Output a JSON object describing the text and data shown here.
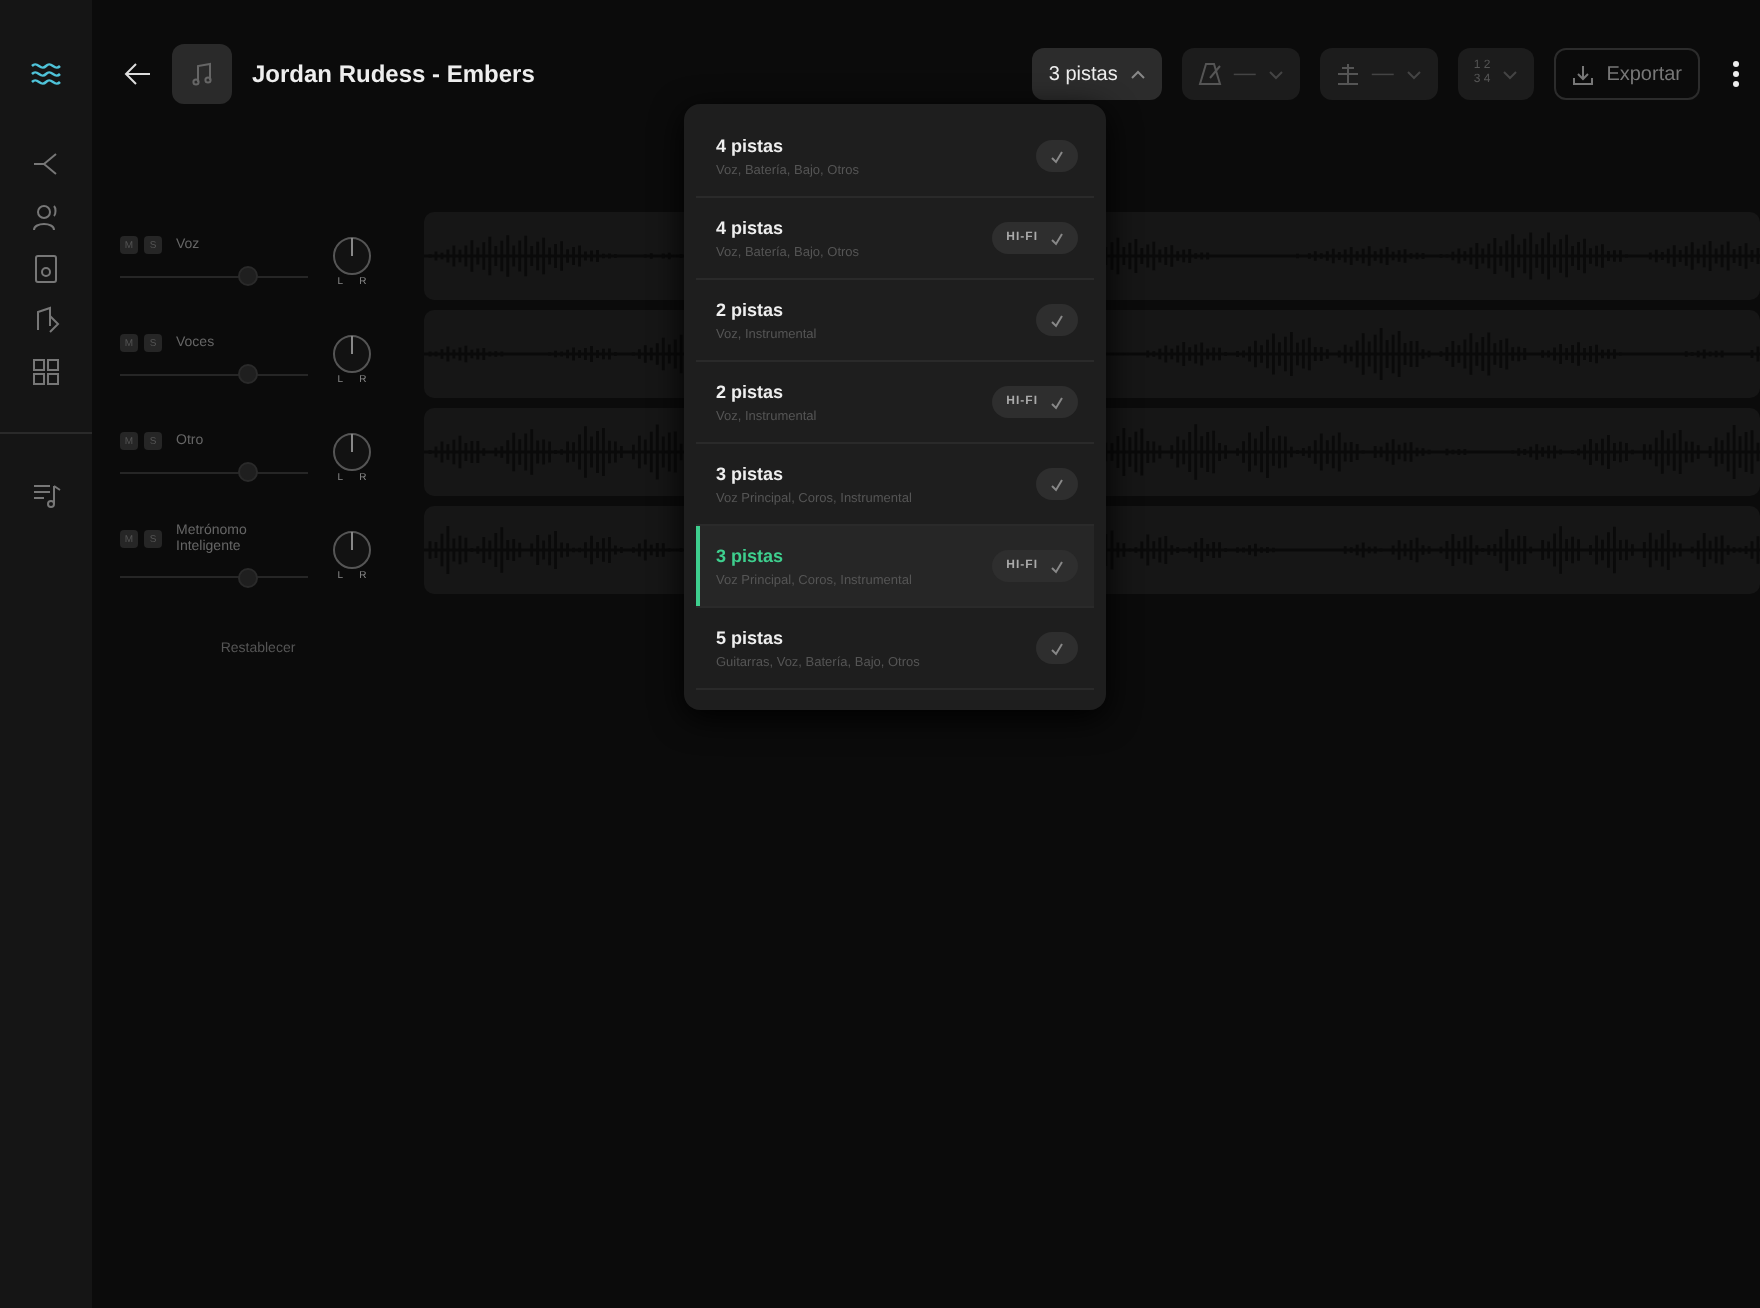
{
  "header": {
    "title": "Jordan Rudess - Embers"
  },
  "toolbar": {
    "stems_label": "3 pistas",
    "metronome_value": "—",
    "tuning_value": "—",
    "time_signature": [
      "1 2",
      "3 4"
    ],
    "export_label": "Exportar"
  },
  "tracks": [
    {
      "name": "Voz",
      "mute_label": "M",
      "solo_label": "S",
      "level": 0.7,
      "pan_left": "L",
      "pan_right": "R"
    },
    {
      "name": "Voces",
      "mute_label": "M",
      "solo_label": "S",
      "level": 0.7,
      "pan_left": "L",
      "pan_right": "R"
    },
    {
      "name": "Otro",
      "mute_label": "M",
      "solo_label": "S",
      "level": 0.7,
      "pan_left": "L",
      "pan_right": "R"
    },
    {
      "name": "Metrónomo Inteligente",
      "mute_label": "M",
      "solo_label": "S",
      "level": 0.7,
      "pan_left": "L",
      "pan_right": "R"
    }
  ],
  "reset_label": "Restablecer",
  "stem_options": [
    {
      "title": "4 pistas",
      "subtitle": "Voz, Batería, Bajo, Otros",
      "hifi": false,
      "selected": false
    },
    {
      "title": "4 pistas",
      "subtitle": "Voz, Batería, Bajo, Otros",
      "hifi": true,
      "hifi_label": "HI-FI",
      "selected": false
    },
    {
      "title": "2 pistas",
      "subtitle": "Voz, Instrumental",
      "hifi": false,
      "selected": false
    },
    {
      "title": "2 pistas",
      "subtitle": "Voz, Instrumental",
      "hifi": true,
      "hifi_label": "HI-FI",
      "selected": false
    },
    {
      "title": "3 pistas",
      "subtitle": "Voz Principal, Coros, Instrumental",
      "hifi": false,
      "selected": false
    },
    {
      "title": "3 pistas",
      "subtitle": "Voz Principal, Coros, Instrumental",
      "hifi": true,
      "hifi_label": "HI-FI",
      "selected": true
    },
    {
      "title": "5 pistas",
      "subtitle": "Guitarras, Voz, Batería, Bajo, Otros",
      "hifi": false,
      "selected": false
    }
  ]
}
